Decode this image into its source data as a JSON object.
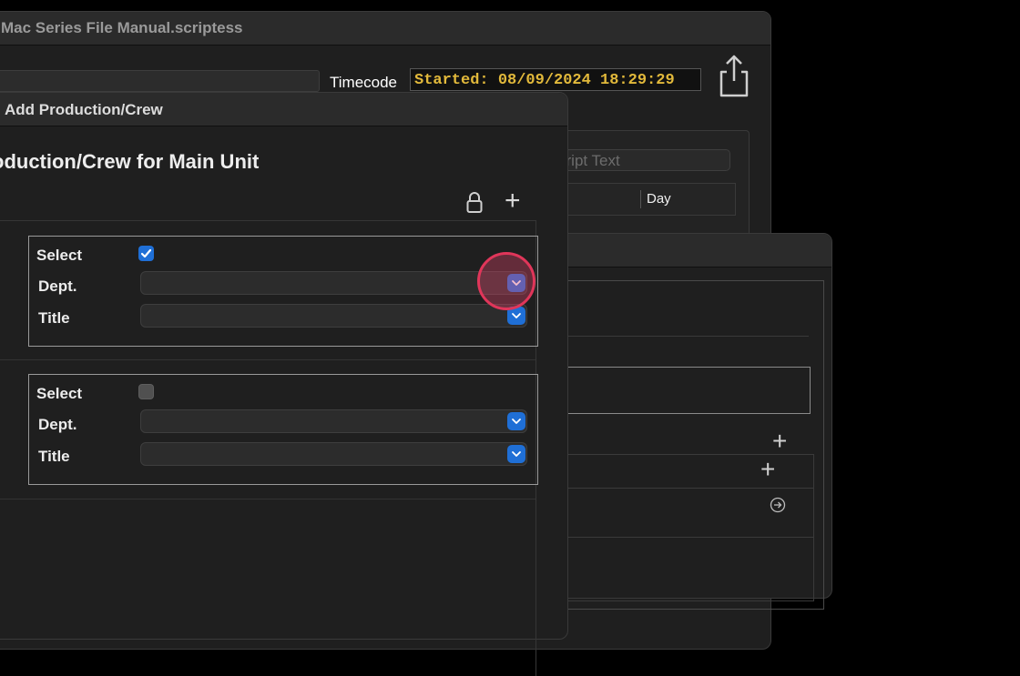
{
  "main_window": {
    "title": "Mac Series File Manual.scriptess",
    "timecode_label": "Timecode",
    "timecode_value": "Started: 08/09/2024 18:29:29",
    "script_search_placeholder": "cript Text",
    "day_column": "Day"
  },
  "sheet": {
    "title": "Add Production/Crew",
    "heading": "oduction/Crew for Main Unit",
    "crew_entries": [
      {
        "select_label": "Select",
        "selected": true,
        "dept_label": "Dept.",
        "dept_value": "",
        "title_label": "Title",
        "title_value": ""
      },
      {
        "select_label": "Select",
        "selected": false,
        "dept_label": "Dept.",
        "dept_value": "",
        "title_label": "Title",
        "title_value": ""
      }
    ]
  },
  "icons": {
    "share": "share-icon",
    "lock": "lock-icon",
    "add": "plus-icon",
    "go": "arrow-circle-icon",
    "chevron": "chevron-down-icon"
  },
  "colors": {
    "accent": "#1f6fd6",
    "timecode": "#e2b93b",
    "click_indicator": "#e0365a"
  }
}
